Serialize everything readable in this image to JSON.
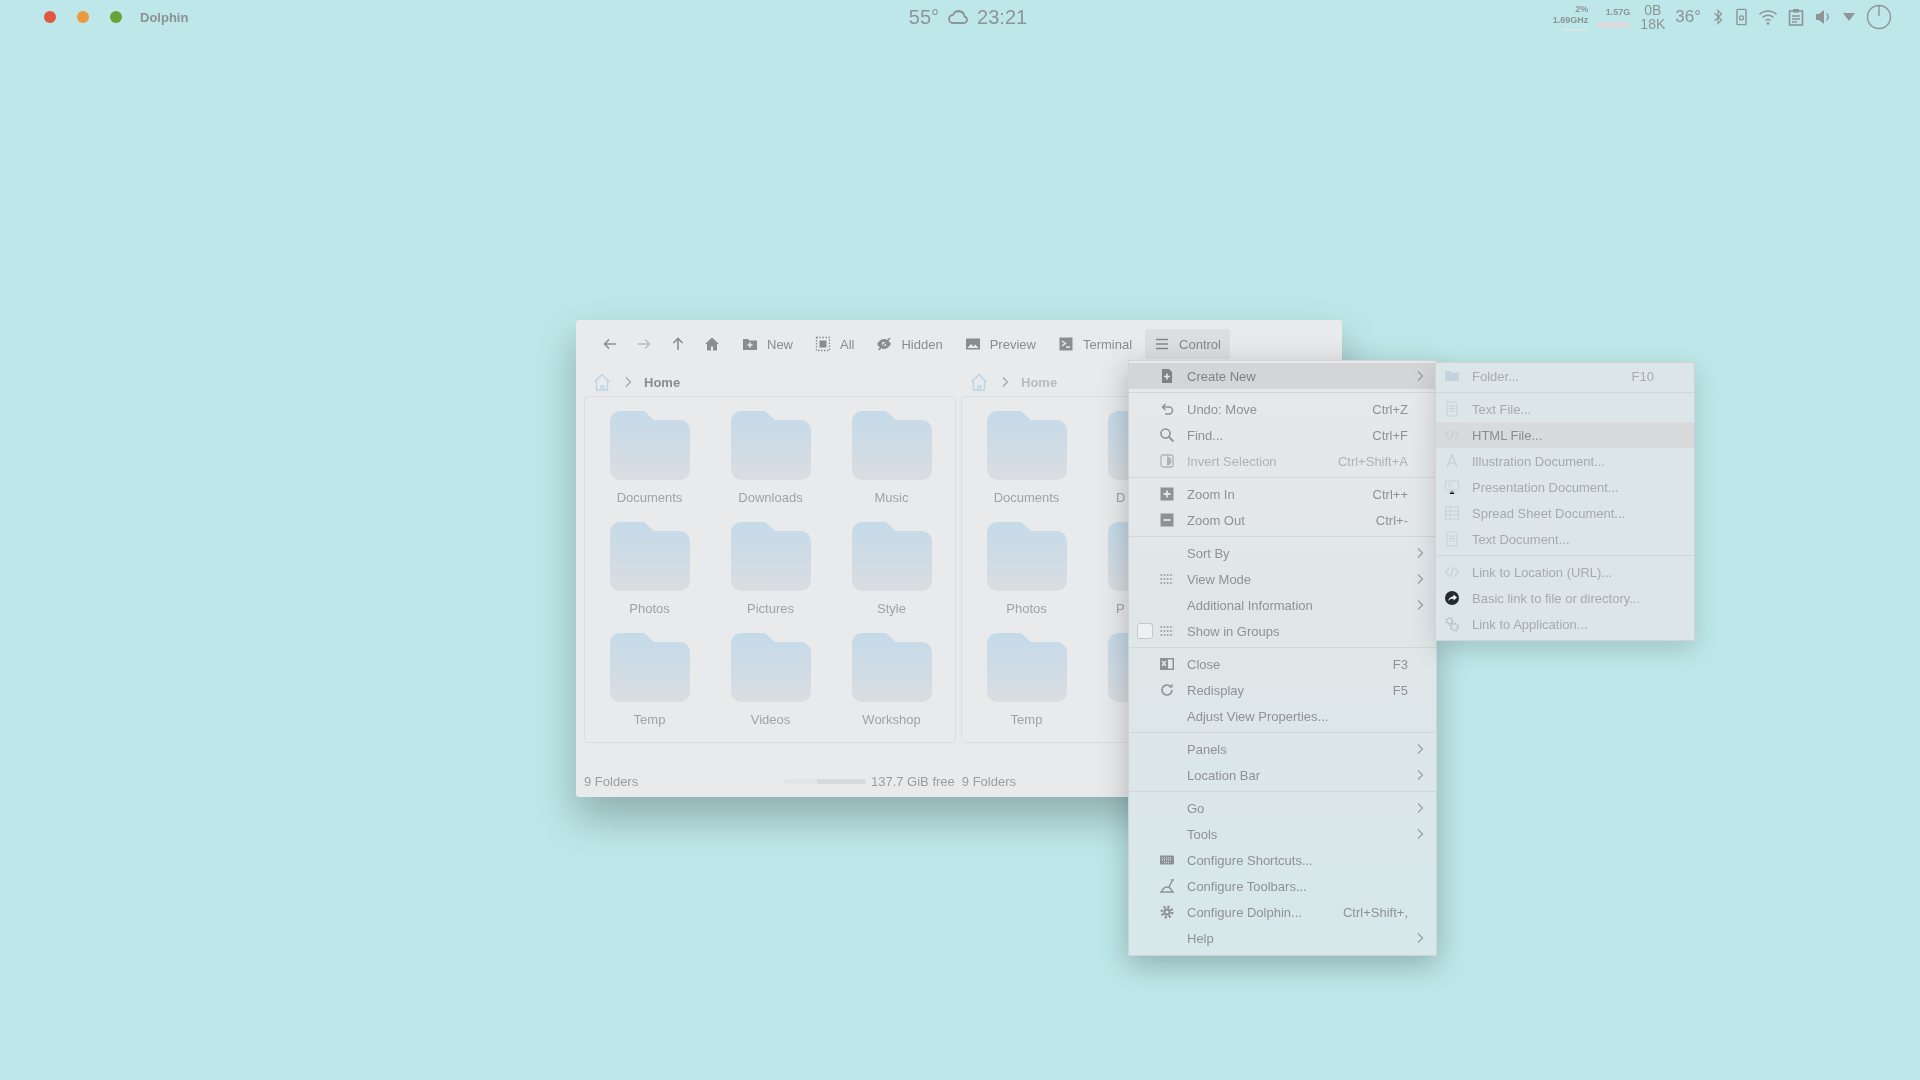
{
  "top_bar": {
    "app_name": "Dolphin",
    "weather": "55°",
    "clock": "23:21",
    "cpu": {
      "percent": "2%",
      "frequency": "1.69GHz"
    },
    "memory": "1.57G",
    "network": {
      "up": "0B",
      "down": "18K"
    },
    "temperature": "36°"
  },
  "window": {
    "nav_buttons": [
      {
        "disabled": false
      },
      {
        "disabled": true
      },
      {
        "disabled": false
      },
      {
        "disabled": false
      }
    ],
    "toolbar": [
      {
        "label": "New",
        "pressed": false
      },
      {
        "label": "All",
        "pressed": false
      },
      {
        "label": "Hidden",
        "pressed": false
      },
      {
        "label": "Preview",
        "pressed": false
      },
      {
        "label": "Terminal",
        "pressed": false
      },
      {
        "label": "Control",
        "pressed": true
      }
    ],
    "panes": [
      {
        "active": true,
        "breadcrumb": "Home",
        "items": [
          {
            "kind": "full",
            "label": "Documents"
          },
          {
            "kind": "full",
            "label": "Downloads"
          },
          {
            "kind": "full",
            "label": "Music"
          },
          {
            "kind": "full",
            "label": "Photos"
          },
          {
            "kind": "full",
            "label": "Pictures"
          },
          {
            "kind": "full",
            "label": "Style"
          },
          {
            "kind": "full",
            "label": "Temp"
          },
          {
            "kind": "full",
            "label": "Videos"
          },
          {
            "kind": "full",
            "label": "Workshop"
          }
        ]
      },
      {
        "active": false,
        "breadcrumb": "Home",
        "items": [
          {
            "kind": "full",
            "label": "Documents"
          },
          {
            "kind": "partial",
            "label": "D"
          },
          {
            "kind": "full",
            "label": "Photos"
          },
          {
            "kind": "partial",
            "label": "P"
          },
          {
            "kind": "full",
            "label": "Temp"
          },
          {
            "kind": "partial"
          }
        ]
      }
    ],
    "status_bar": {
      "left_count": "9 Folders",
      "space": {
        "level": 0.4
      },
      "free_space": "137.7 GiB free",
      "right_count": "9 Folders"
    }
  },
  "menu": {
    "sections": [
      [
        {
          "label": "Create New",
          "submenu": true,
          "selected": true,
          "disabled": false
        }
      ],
      [
        {
          "label": "Undo: Move",
          "shortcut": "Ctrl+Z",
          "submenu": false,
          "selected": false,
          "disabled": false
        },
        {
          "label": "Find...",
          "shortcut": "Ctrl+F",
          "submenu": false,
          "selected": false,
          "disabled": false
        },
        {
          "label": "Invert Selection",
          "shortcut": "Ctrl+Shift+A",
          "submenu": false,
          "selected": false,
          "disabled": true
        }
      ],
      [
        {
          "label": "Zoom In",
          "shortcut": "Ctrl++",
          "submenu": false,
          "selected": false,
          "disabled": false
        },
        {
          "label": "Zoom Out",
          "shortcut": "Ctrl+-",
          "submenu": false,
          "selected": false,
          "disabled": false
        }
      ],
      [
        {
          "label": "Sort By",
          "submenu": true,
          "selected": false,
          "disabled": false
        },
        {
          "label": "View Mode",
          "submenu": true,
          "selected": false,
          "disabled": false
        },
        {
          "label": "Additional Information",
          "submenu": true,
          "selected": false,
          "disabled": false
        },
        {
          "label": "Show in Groups",
          "submenu": false,
          "selected": false,
          "disabled": false,
          "checked": false
        }
      ],
      [
        {
          "label": "Close",
          "shortcut": "F3",
          "submenu": false,
          "selected": false,
          "disabled": false
        },
        {
          "label": "Redisplay",
          "shortcut": "F5",
          "submenu": false,
          "selected": false,
          "disabled": false
        },
        {
          "label": "Adjust View Properties...",
          "submenu": false,
          "selected": false,
          "disabled": false
        }
      ],
      [
        {
          "label": "Panels",
          "submenu": true,
          "selected": false,
          "disabled": false
        },
        {
          "label": "Location Bar",
          "submenu": true,
          "selected": false,
          "disabled": false
        }
      ],
      [
        {
          "label": "Go",
          "submenu": true,
          "selected": false,
          "disabled": false
        },
        {
          "label": "Tools",
          "submenu": true,
          "selected": false,
          "disabled": false
        },
        {
          "label": "Configure Shortcuts...",
          "submenu": false,
          "selected": false,
          "disabled": false
        },
        {
          "label": "Configure Toolbars...",
          "submenu": false,
          "selected": false,
          "disabled": false
        },
        {
          "label": "Configure Dolphin...",
          "shortcut": "Ctrl+Shift+,",
          "submenu": false,
          "selected": false,
          "disabled": false
        },
        {
          "label": "Help",
          "submenu": true,
          "selected": false,
          "disabled": false
        }
      ]
    ]
  },
  "submenu": {
    "sections": [
      [
        {
          "label": "Folder...",
          "shortcut": "F10",
          "selected": false
        }
      ],
      [
        {
          "label": "Text File...",
          "selected": false
        },
        {
          "label": "HTML File...",
          "selected": true
        },
        {
          "label": "Illustration Document...",
          "selected": false
        },
        {
          "label": "Presentation Document...",
          "selected": false
        },
        {
          "label": "Spread Sheet Document...",
          "selected": false
        },
        {
          "label": "Text Document...",
          "selected": false
        }
      ],
      [
        {
          "label": "Link to Location (URL)...",
          "selected": false
        },
        {
          "label": "Basic link to file or directory...",
          "selected": false
        },
        {
          "label": "Link to Application...",
          "selected": false
        }
      ]
    ]
  }
}
